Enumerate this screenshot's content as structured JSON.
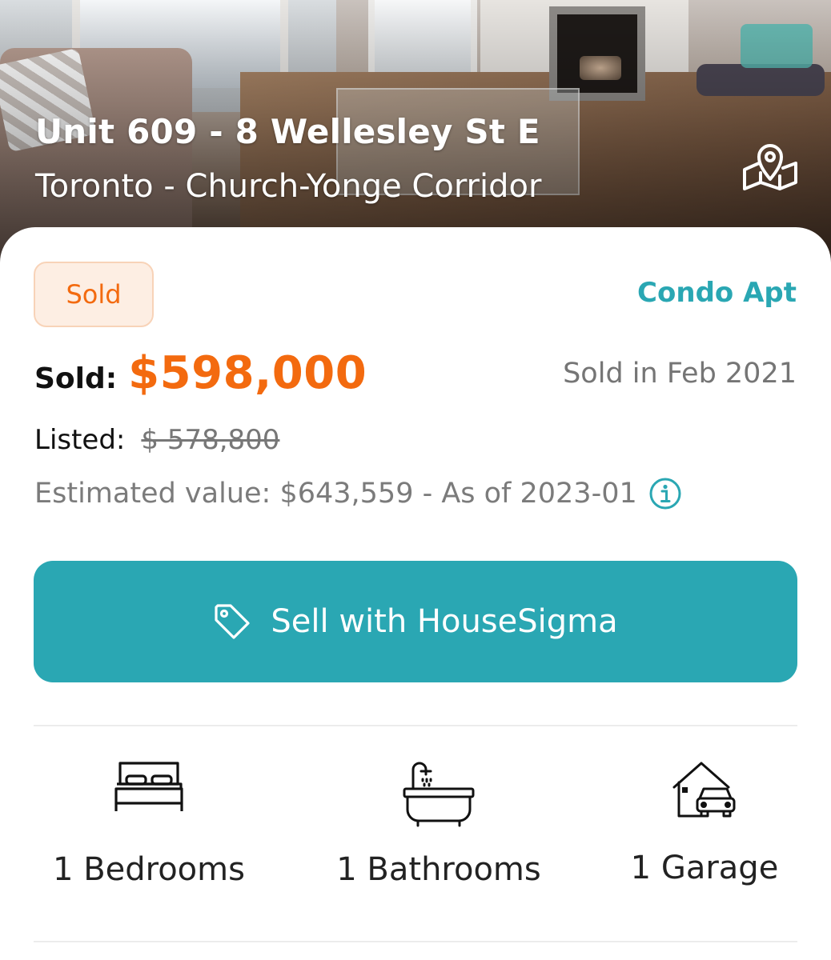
{
  "listing": {
    "address": "Unit 609 - 8 Wellesley St E",
    "area": "Toronto - Church-Yonge Corridor",
    "status": "Sold",
    "property_type": "Condo Apt",
    "sold_label": "Sold:",
    "sold_price": "$598,000",
    "sold_date": "Sold in Feb 2021",
    "listed_label": "Listed:",
    "listed_price": "$ 578,800",
    "estimated_value": "Estimated value: $643,559 - As of 2023-01"
  },
  "actions": {
    "sell_label": "Sell with HouseSigma"
  },
  "features": [
    {
      "label": "1 Bedrooms",
      "icon": "bed-icon"
    },
    {
      "label": "1 Bathrooms",
      "icon": "bathtub-icon"
    },
    {
      "label": "1 Garage",
      "icon": "garage-icon"
    }
  ],
  "icons": {
    "map": "map-pin-icon",
    "info": "info-icon",
    "tag": "tag-icon"
  },
  "colors": {
    "accent": "#2aa7b3",
    "sold_orange": "#f36a0f",
    "badge_bg": "#fdeee3"
  }
}
